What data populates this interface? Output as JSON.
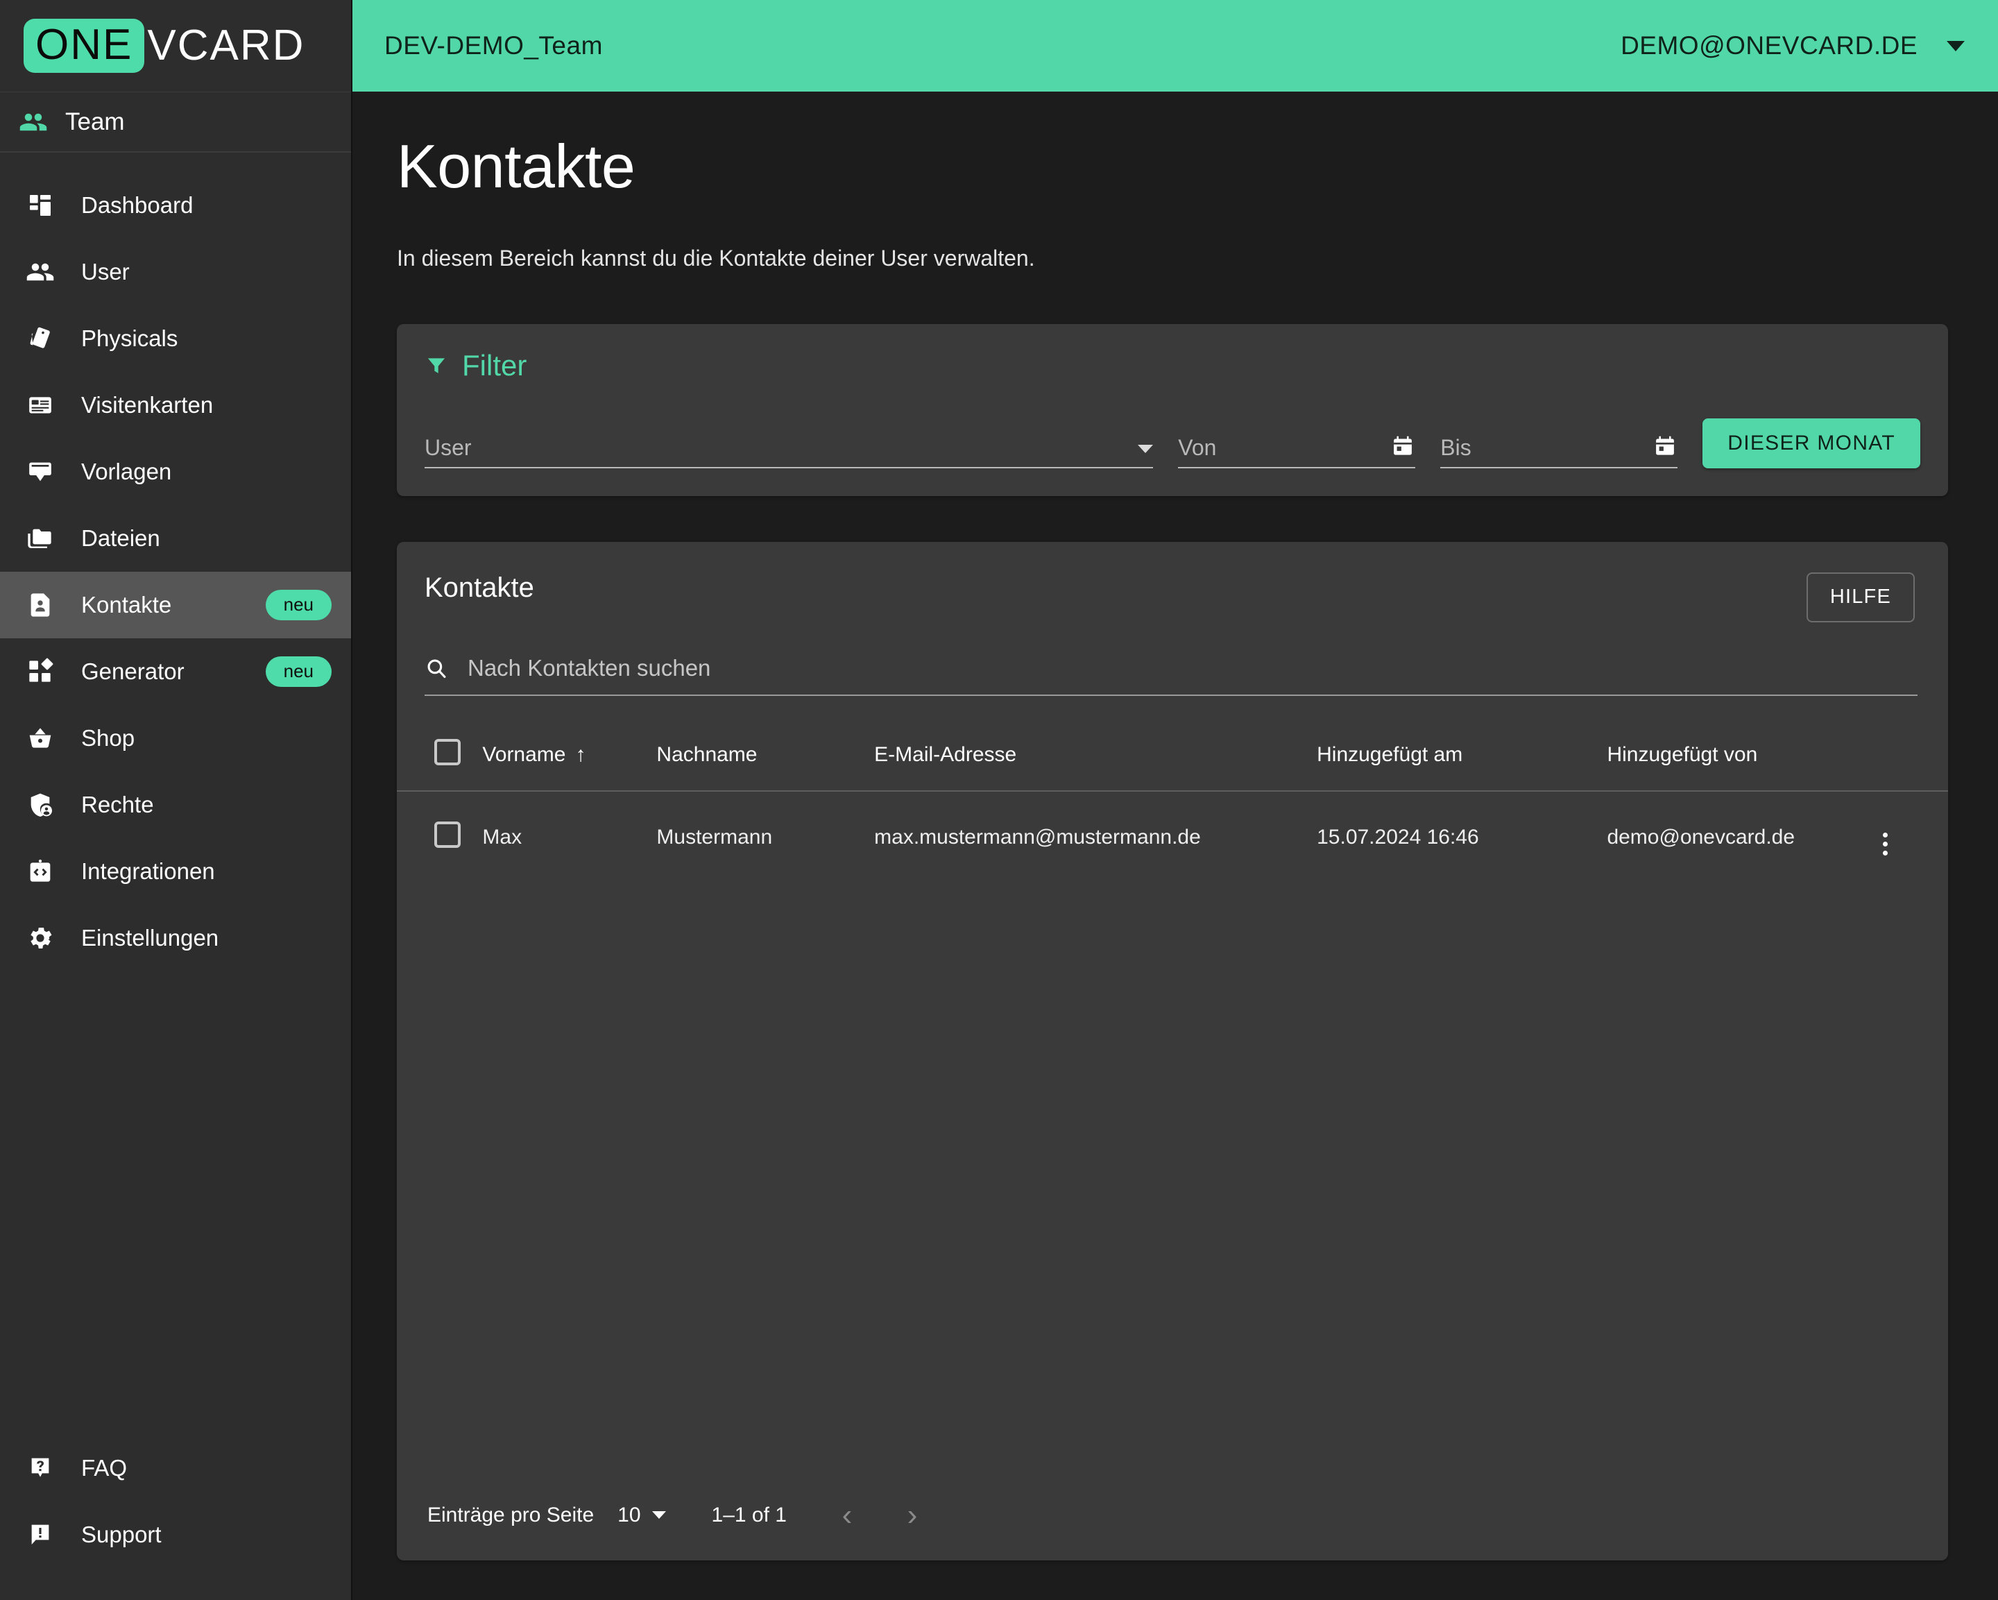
{
  "brand": {
    "logo_primary": "ONE",
    "logo_secondary": "VCARD",
    "accent_color": "#52d8a8",
    "sidebar_color": "#2d2d2d",
    "page_bg_color": "#1c1c1c",
    "card_color": "#3a3a3a"
  },
  "topbar": {
    "team_name": "DEV-DEMO_Team",
    "account_email": "DEMO@ONEVCARD.DE",
    "dropdown_icon": "chevron-down-icon"
  },
  "sidebar": {
    "team_section": {
      "label": "Team",
      "icon": "people-icon"
    },
    "items": [
      {
        "label": "Dashboard",
        "icon": "dashboard-icon",
        "badge": null,
        "active": false
      },
      {
        "label": "User",
        "icon": "people-icon",
        "badge": null,
        "active": false
      },
      {
        "label": "Physicals",
        "icon": "cards-icon",
        "badge": null,
        "active": false
      },
      {
        "label": "Visitenkarten",
        "icon": "business-card-icon",
        "badge": null,
        "active": false
      },
      {
        "label": "Vorlagen",
        "icon": "template-icon",
        "badge": null,
        "active": false
      },
      {
        "label": "Dateien",
        "icon": "folder-icon",
        "badge": null,
        "active": false
      },
      {
        "label": "Kontakte",
        "icon": "contact-page-icon",
        "badge": "neu",
        "active": true
      },
      {
        "label": "Generator",
        "icon": "generator-icon",
        "badge": "neu",
        "active": false
      },
      {
        "label": "Shop",
        "icon": "basket-icon",
        "badge": null,
        "active": false
      },
      {
        "label": "Rechte",
        "icon": "shield-user-icon",
        "badge": null,
        "active": false
      },
      {
        "label": "Integrationen",
        "icon": "code-badge-icon",
        "badge": null,
        "active": false
      },
      {
        "label": "Einstellungen",
        "icon": "gear-icon",
        "badge": null,
        "active": false
      }
    ],
    "bottom_items": [
      {
        "label": "FAQ",
        "icon": "question-bubble-icon"
      },
      {
        "label": "Support",
        "icon": "alert-bubble-icon"
      }
    ]
  },
  "page": {
    "title": "Kontakte",
    "description": "In diesem Bereich kannst du die Kontakte deiner User verwalten."
  },
  "filter": {
    "title": "Filter",
    "icon": "funnel-icon",
    "user_select": {
      "placeholder": "User",
      "value": "",
      "caret_icon": "caret-down-icon"
    },
    "date_from": {
      "placeholder": "Von",
      "value": "",
      "icon": "calendar-icon"
    },
    "date_to": {
      "placeholder": "Bis",
      "value": "",
      "icon": "calendar-icon"
    },
    "this_month_button": "DIESER MONAT"
  },
  "contacts_card": {
    "title": "Kontakte",
    "help_button": "HILFE",
    "search": {
      "placeholder": "Nach Kontakten suchen",
      "value": "",
      "icon": "search-icon"
    },
    "columns": [
      {
        "key": "check",
        "label": ""
      },
      {
        "key": "vorname",
        "label": "Vorname",
        "sorted": "asc",
        "sort_icon": "arrow-up-icon"
      },
      {
        "key": "nachname",
        "label": "Nachname"
      },
      {
        "key": "email",
        "label": "E-Mail-Adresse"
      },
      {
        "key": "datum",
        "label": "Hinzugefügt am"
      },
      {
        "key": "von",
        "label": "Hinzugefügt von"
      },
      {
        "key": "menu",
        "label": ""
      }
    ],
    "rows": [
      {
        "vorname": "Max",
        "nachname": "Mustermann",
        "email": "max.mustermann@mustermann.de",
        "datum": "15.07.2024 16:46",
        "von": "demo@onevcard.de",
        "menu_icon": "more-vert-icon",
        "selected": false
      }
    ],
    "pagination": {
      "per_page_label": "Einträge pro Seite",
      "per_page_value": "10",
      "range_label": "1–1 of 1",
      "prev_icon": "chevron-left-icon",
      "next_icon": "chevron-right-icon"
    }
  }
}
